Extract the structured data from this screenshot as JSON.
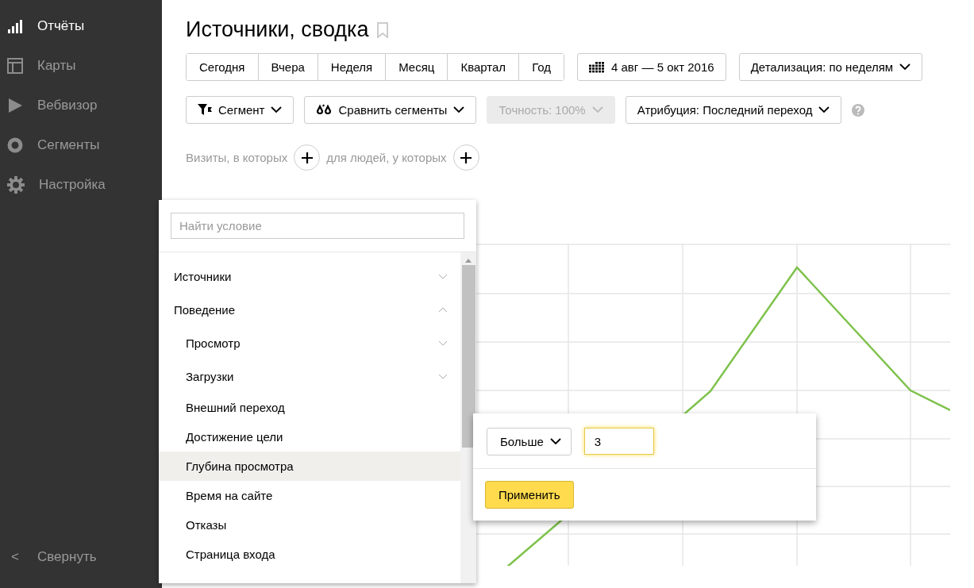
{
  "sidebar": {
    "items": [
      {
        "label": "Отчёты",
        "selected": true
      },
      {
        "label": "Карты",
        "selected": false
      },
      {
        "label": "Вебвизор",
        "selected": false
      },
      {
        "label": "Сегменты",
        "selected": false
      },
      {
        "label": "Настройка",
        "selected": false
      }
    ],
    "collapse": {
      "arrow": "<",
      "label": "Свернуть"
    }
  },
  "title": "Источники, сводка",
  "periods": [
    {
      "label": "Сегодня",
      "selected": false
    },
    {
      "label": "Вчера",
      "selected": false
    },
    {
      "label": "Неделя",
      "selected": false
    },
    {
      "label": "Месяц",
      "selected": false
    },
    {
      "label": "Квартал",
      "selected": false
    },
    {
      "label": "Год",
      "selected": false
    }
  ],
  "date_range": "4 авг — 5 окт 2016",
  "detail": "Детализация: по неделям",
  "filters": [
    {
      "label": "Сегмент",
      "disabled": false
    },
    {
      "label": "Сравнить сегменты",
      "disabled": false
    },
    {
      "label": "Точность: 100%",
      "disabled": true
    },
    {
      "label": "Атрибуция: Последний переход",
      "disabled": false
    }
  ],
  "segment_line": [
    "Визиты, в которых",
    "для людей, у которых"
  ],
  "condition_menu": {
    "placeholder": "Найти условие",
    "items": [
      {
        "label": "Источники",
        "kind": "group",
        "expanded": false,
        "selected": false
      },
      {
        "label": "Поведение",
        "kind": "group",
        "expanded": true,
        "selected": false,
        "children": [
          {
            "label": "Просмотр",
            "kind": "group",
            "expanded": false,
            "selected": false
          },
          {
            "label": "Загрузки",
            "kind": "group",
            "expanded": false,
            "selected": false
          },
          {
            "label": "Внешний переход",
            "kind": "leaf",
            "selected": false
          },
          {
            "label": "Достижение цели",
            "kind": "leaf",
            "selected": false
          },
          {
            "label": "Глубина просмотра",
            "kind": "leaf",
            "selected": true
          },
          {
            "label": "Время на сайте",
            "kind": "leaf",
            "selected": false
          },
          {
            "label": "Отказы",
            "kind": "leaf",
            "selected": false
          },
          {
            "label": "Страница входа",
            "kind": "leaf",
            "selected": false
          }
        ]
      }
    ]
  },
  "condition_popup": {
    "operator": "Больше",
    "value": "3",
    "apply": "Применить"
  }
}
